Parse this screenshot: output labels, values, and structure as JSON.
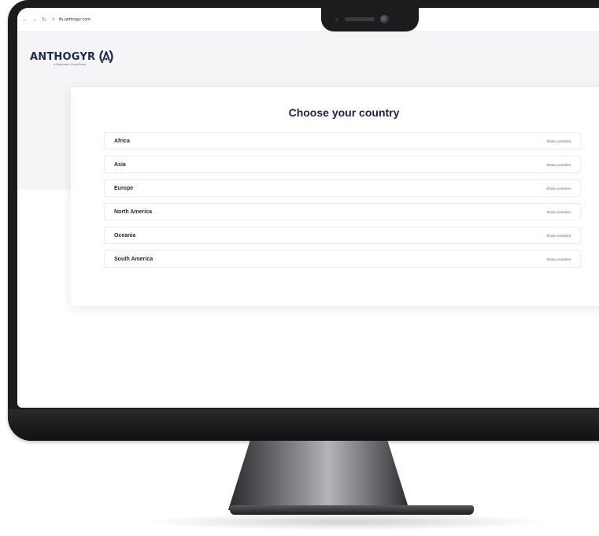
{
  "browser": {
    "back_icon": "arrow-left-icon",
    "forward_icon": "arrow-right-icon",
    "reload_icon": "reload-icon",
    "url": "ifu.anthogyr.com"
  },
  "brand": {
    "name": "ANTHOGYR",
    "tagline": "A Straumann Group Brand",
    "color": "#1e2756"
  },
  "main": {
    "title": "Choose your country",
    "regions": [
      {
        "name": "Africa",
        "action": "Show countries"
      },
      {
        "name": "Asia",
        "action": "Show countries"
      },
      {
        "name": "Europe",
        "action": "Show countries"
      },
      {
        "name": "North America",
        "action": "Show countries"
      },
      {
        "name": "Oceania",
        "action": "Show countries"
      },
      {
        "name": "South America",
        "action": "Show countries"
      }
    ]
  },
  "colors": {
    "link": "#4a5fb8",
    "header_bg": "#f5f5f7"
  }
}
